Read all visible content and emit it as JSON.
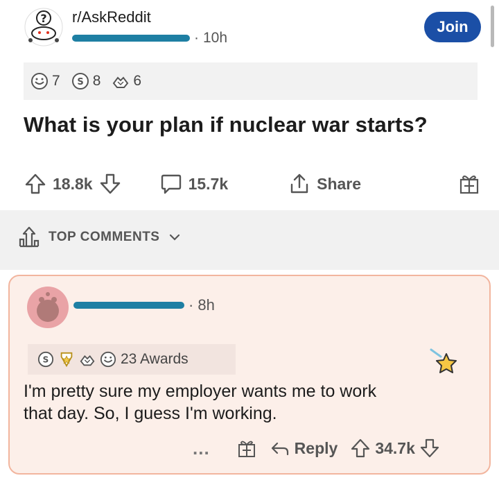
{
  "post": {
    "subreddit": "r/AskReddit",
    "posted_ago": "10h",
    "join_label": "Join",
    "title": "What is your plan if nuclear war starts?",
    "awards": [
      {
        "icon": "wholesome-award-icon",
        "count": "7"
      },
      {
        "icon": "silver-award-icon",
        "count": "8"
      },
      {
        "icon": "helpful-hands-award-icon",
        "count": "6"
      }
    ],
    "score": "18.8k",
    "comments_count": "15.7k",
    "share_label": "Share"
  },
  "sort": {
    "label": "TOP COMMENTS"
  },
  "comment": {
    "posted_ago": "8h",
    "awards_label": "23 Awards",
    "text_line1": "I'm pretty sure my employer wants me to work",
    "text_line2": "that day. So, I guess I'm working.",
    "more_label": "...",
    "reply_label": "Reply",
    "score": "34.7k"
  },
  "colors": {
    "join_button": "#1b4fa6",
    "redaction_marker": "#1e7fa3",
    "comment_background": "#fcefe9",
    "comment_border": "#f2b59e",
    "avatar_pink": "#e9a3a6"
  }
}
